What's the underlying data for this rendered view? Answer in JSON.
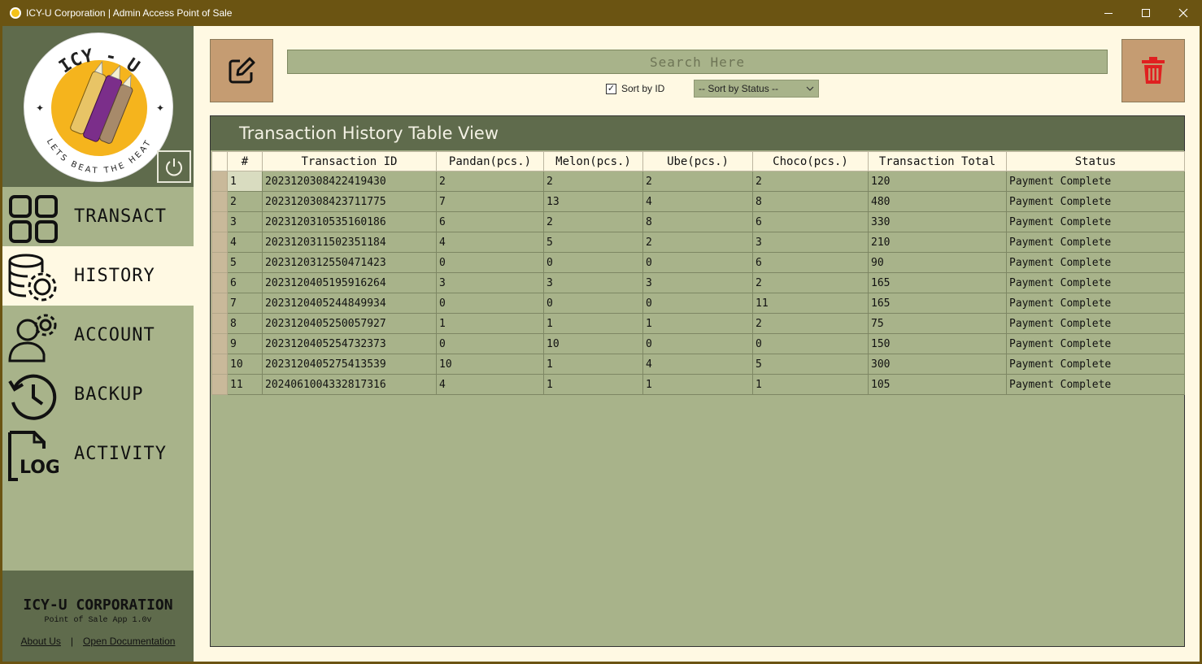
{
  "window": {
    "title": "ICY-U Corporation | Admin Access Point of Sale"
  },
  "logo": {
    "text_top": "ICY - U",
    "text_bottom": "LETS BEAT THE HEAT"
  },
  "sidebar": {
    "items": [
      {
        "label": "TRANSACT",
        "icon": "grid-icon"
      },
      {
        "label": "HISTORY",
        "icon": "database-gear-icon"
      },
      {
        "label": "ACCOUNT",
        "icon": "user-gear-icon"
      },
      {
        "label": "BACKUP",
        "icon": "history-clock-icon"
      },
      {
        "label": "ACTIVITY",
        "icon": "log-file-icon"
      }
    ],
    "active": "HISTORY",
    "footer": {
      "company": "ICY-U CORPORATION",
      "version": "Point of Sale App 1.0v",
      "about": "About Us",
      "separator": "|",
      "docs": "Open Documentation"
    }
  },
  "toolbar": {
    "search_placeholder": "Search Here",
    "sort_by_id_label": "Sort by ID",
    "sort_by_id_checked": true,
    "status_select_value": "-- Sort by Status --"
  },
  "panel": {
    "title": "Transaction History Table View"
  },
  "table": {
    "columns": [
      "#",
      "Transaction ID",
      "Pandan(pcs.)",
      "Melon(pcs.)",
      "Ube(pcs.)",
      "Choco(pcs.)",
      "Transaction Total",
      "Status"
    ],
    "rows": [
      [
        "1",
        "2023120308422419430",
        "2",
        "2",
        "2",
        "2",
        "120",
        "Payment Complete"
      ],
      [
        "2",
        "2023120308423711775",
        "7",
        "13",
        "4",
        "8",
        "480",
        "Payment Complete"
      ],
      [
        "3",
        "2023120310535160186",
        "6",
        "2",
        "8",
        "6",
        "330",
        "Payment Complete"
      ],
      [
        "4",
        "2023120311502351184",
        "4",
        "5",
        "2",
        "3",
        "210",
        "Payment Complete"
      ],
      [
        "5",
        "2023120312550471423",
        "0",
        "0",
        "0",
        "6",
        "90",
        "Payment Complete"
      ],
      [
        "6",
        "2023120405195916264",
        "3",
        "3",
        "3",
        "2",
        "165",
        "Payment Complete"
      ],
      [
        "7",
        "2023120405244849934",
        "0",
        "0",
        "0",
        "11",
        "165",
        "Payment Complete"
      ],
      [
        "8",
        "2023120405250057927",
        "1",
        "1",
        "1",
        "2",
        "75",
        "Payment Complete"
      ],
      [
        "9",
        "2023120405254732373",
        "0",
        "10",
        "0",
        "0",
        "150",
        "Payment Complete"
      ],
      [
        "10",
        "2023120405275413539",
        "10",
        "1",
        "4",
        "5",
        "300",
        "Payment Complete"
      ],
      [
        "11",
        "2024061004332817316",
        "4",
        "1",
        "1",
        "1",
        "105",
        "Payment Complete"
      ]
    ]
  },
  "colors": {
    "titlebar": "#6b5412",
    "sidebar": "#a8b38a",
    "dark_olive": "#5f6b4c",
    "cream": "#fff9e3",
    "button": "#c59c72",
    "delete_icon": "#e02020"
  }
}
